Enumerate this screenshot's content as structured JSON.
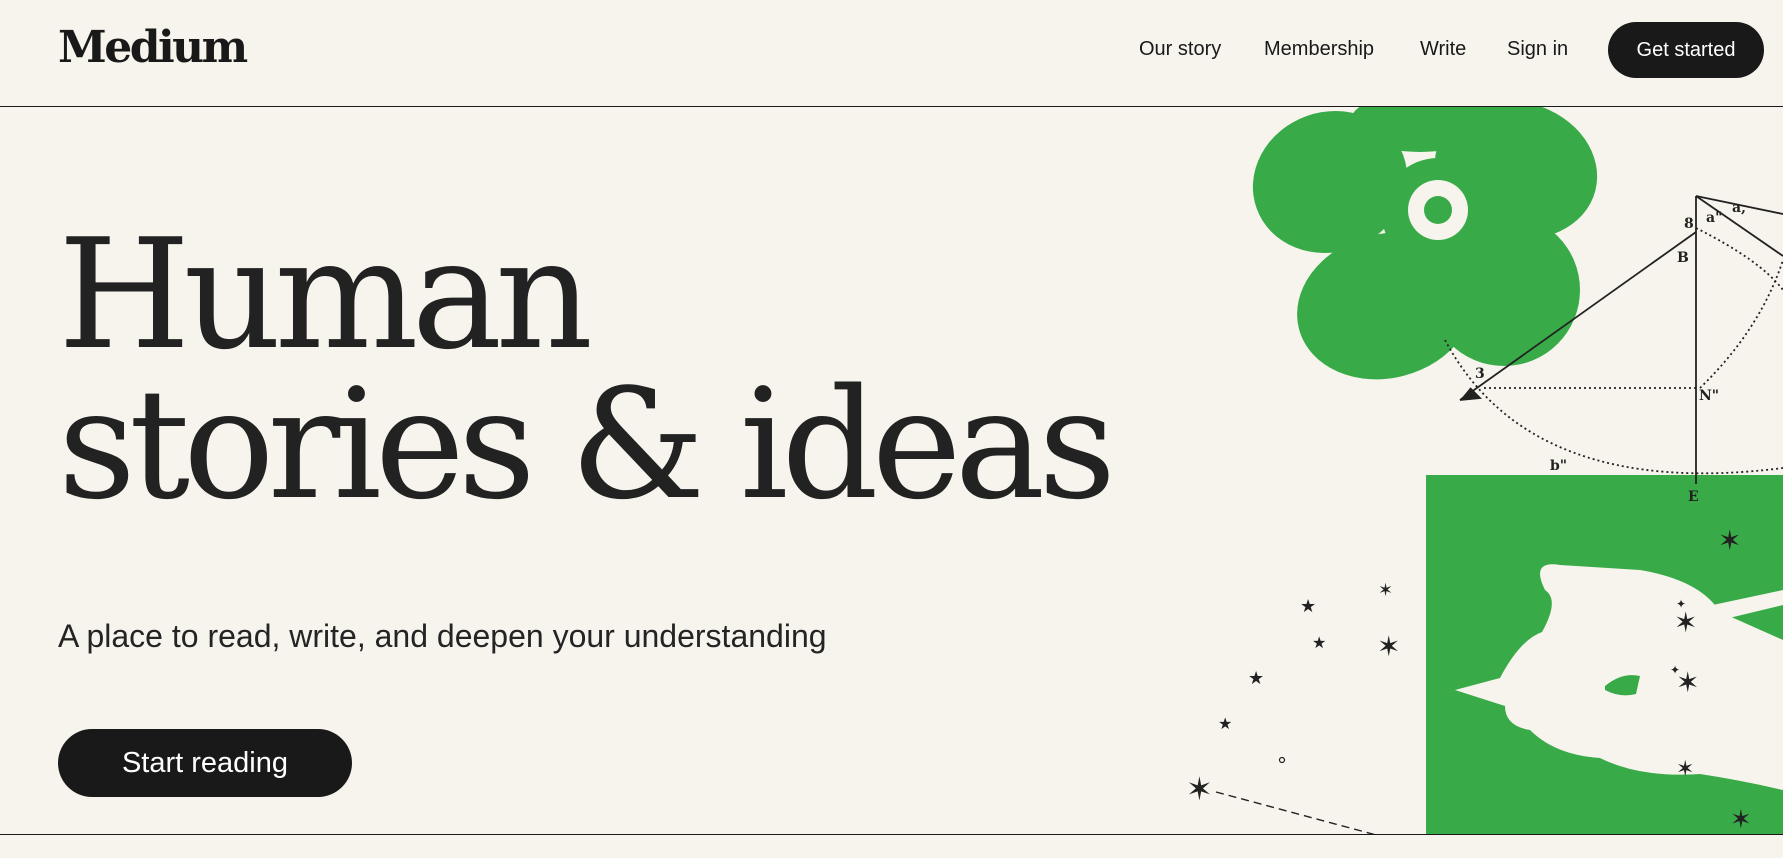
{
  "header": {
    "logo": "Medium",
    "nav": {
      "our_story": "Our story",
      "membership": "Membership",
      "write": "Write",
      "sign_in": "Sign in"
    },
    "get_started_label": "Get started"
  },
  "hero": {
    "title_line1": "Human",
    "title_line2": "stories & ideas",
    "subtitle": "A place to read, write, and deepen your understanding",
    "start_reading_label": "Start reading"
  },
  "illustration": {
    "labels": {
      "B": "B",
      "E": "E",
      "N": "N\"",
      "b": "b\"",
      "three": "3",
      "eight": "8",
      "a1": "a,",
      "a2": "a\""
    }
  },
  "colors": {
    "background": "#f7f4ed",
    "text": "#191919",
    "accent_green": "#38ab48",
    "button_bg": "#191919",
    "button_text": "#ffffff"
  },
  "icons": {
    "flower": "green-flower-illustration",
    "hand": "hand-writing-illustration",
    "stars": "star-sparkle-icons"
  }
}
